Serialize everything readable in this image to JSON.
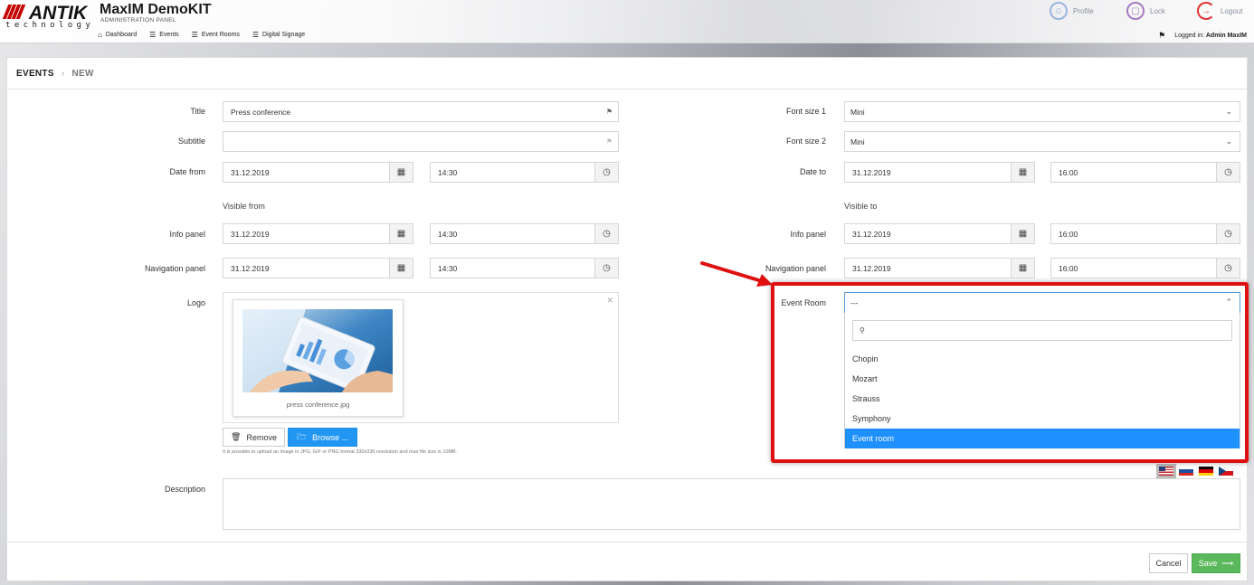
{
  "brand": {
    "logo_word": "ANTIK",
    "logo_tagline": "technology",
    "app_title": "MaxIM DemoKIT",
    "app_subtitle": "ADMINISTRATION PANEL"
  },
  "topnav": [
    {
      "label": "Dashboard",
      "icon": "home-icon"
    },
    {
      "label": "Events",
      "icon": "list-icon"
    },
    {
      "label": "Event Rooms",
      "icon": "list-icon"
    },
    {
      "label": "Digital Signage",
      "icon": "list-icon"
    }
  ],
  "header_actions": {
    "profile": "Profile",
    "lock": "Lock",
    "logout": "Logout",
    "logged_in_prefix": "Logged in:",
    "logged_in_user": "Admin MaxIM"
  },
  "breadcrumb": {
    "parent": "EVENTS",
    "current": "NEW"
  },
  "form": {
    "title_label": "Title",
    "title_value": "Press conference",
    "subtitle_label": "Subtitle",
    "subtitle_value": "",
    "date_from_label": "Date from",
    "date_from_date": "31.12.2019",
    "date_from_time": "14:30",
    "font_size_1_label": "Font size 1",
    "font_size_1_value": "Mini",
    "font_size_2_label": "Font size 2",
    "font_size_2_value": "Mini",
    "date_to_label": "Date to",
    "date_to_date": "31.12.2019",
    "date_to_time": "16:00",
    "visible_from_label": "Visible from",
    "visible_to_label": "Visible to",
    "info_panel_label": "Info panel",
    "info_from_date": "31.12.2019",
    "info_from_time": "14:30",
    "info_to_date": "31.12.2019",
    "info_to_time": "16:00",
    "nav_panel_label": "Navigation panel",
    "nav_from_date": "31.12.2019",
    "nav_from_time": "14:30",
    "nav_to_date": "31.12.2019",
    "nav_to_time": "16:00",
    "logo_label": "Logo",
    "logo_filename": "press conference.jpg",
    "remove_label": "Remove",
    "browse_label": "Browse ...",
    "upload_hint": "It is possible to upload an image in JPG, GIF or PNG format 330x330 resolution and max file size is 10MB.",
    "event_room_label": "Event Room",
    "event_room_value": "---",
    "event_room_options": [
      "Chopin",
      "Mozart",
      "Strauss",
      "Symphony",
      "Event room"
    ],
    "event_room_selected": "Event room",
    "description_label": "Description",
    "description_value": ""
  },
  "language_flags": [
    "us-flag-icon",
    "sk-flag-icon",
    "de-flag-icon",
    "cz-flag-icon"
  ],
  "footer": {
    "cancel_label": "Cancel",
    "save_label": "Save"
  },
  "colors": {
    "accent": "#2196f3",
    "save": "#5cb85c",
    "highlight": "#e01010",
    "brand_red": "#c40000"
  }
}
